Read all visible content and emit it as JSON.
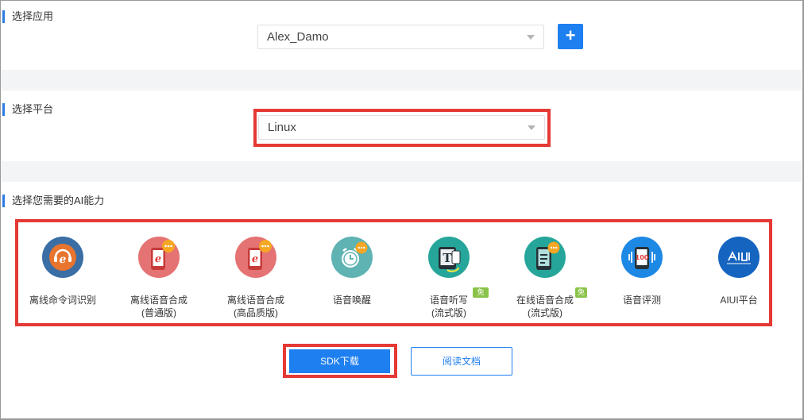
{
  "sections": {
    "app": {
      "title": "选择应用",
      "selected": "Alex_Damo",
      "add_label": "+"
    },
    "platform": {
      "title": "选择平台",
      "selected": "Linux"
    },
    "abilities": {
      "title": "选择您需要的AI能力",
      "items": [
        {
          "line1": "离线命令词识别",
          "line2": "",
          "icon": "offline-command-icon",
          "badge": ""
        },
        {
          "line1": "离线语音合成",
          "line2": "(普通版)",
          "icon": "offline-tts-normal-icon",
          "badge": ""
        },
        {
          "line1": "离线语音合成",
          "line2": "(高品质版)",
          "icon": "offline-tts-hq-icon",
          "badge": ""
        },
        {
          "line1": "语音唤醒",
          "line2": "",
          "icon": "voice-wakeup-icon",
          "badge": ""
        },
        {
          "line1": "语音听写",
          "line2": "(流式版)",
          "icon": "voice-dictation-icon",
          "badge": "免费"
        },
        {
          "line1": "在线语音合成",
          "line2": "(流式版)",
          "icon": "online-tts-icon",
          "badge": "免费"
        },
        {
          "line1": "语音评测",
          "line2": "",
          "icon": "voice-evaluation-icon",
          "badge": ""
        },
        {
          "line1": "AIUI平台",
          "line2": "",
          "icon": "aiui-platform-icon",
          "badge": ""
        }
      ]
    }
  },
  "actions": {
    "sdk_download": "SDK下载",
    "read_docs": "阅读文档"
  },
  "colors": {
    "accent": "#1e7ff0",
    "highlight": "#e53935",
    "badge": "#8bc34a"
  }
}
